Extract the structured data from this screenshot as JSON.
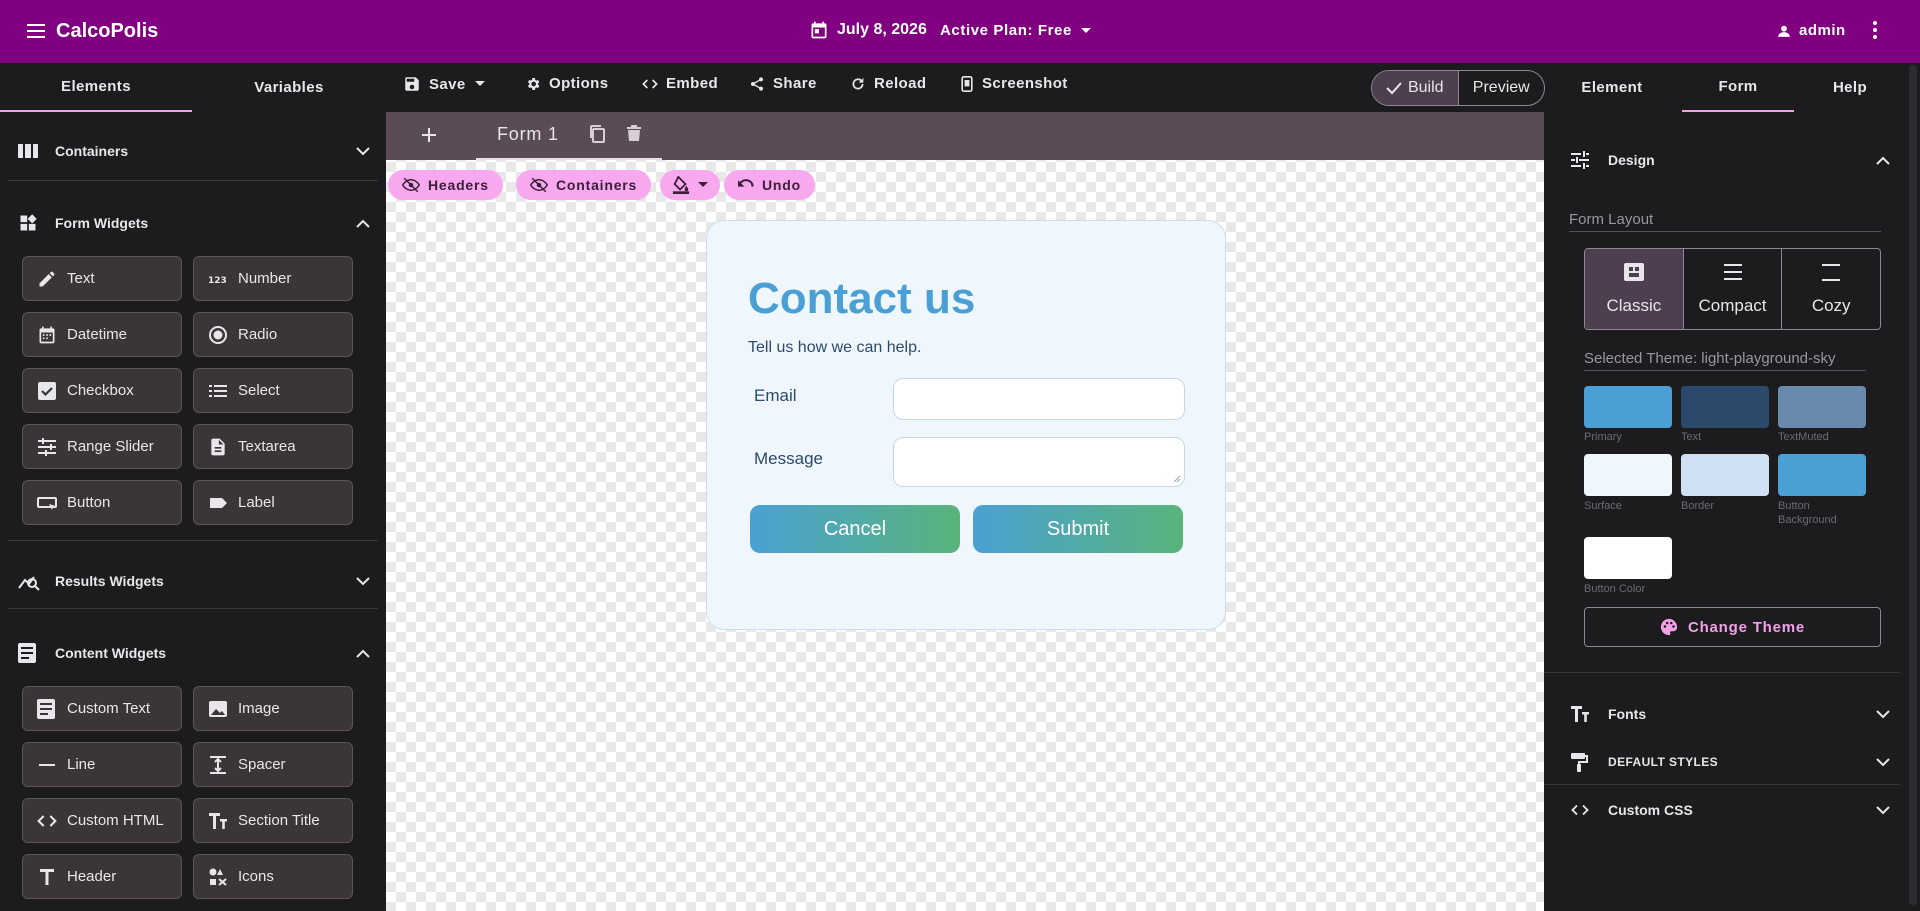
{
  "topbar": {
    "app_title": "CalcoPolis",
    "date": "July 8, 2026",
    "plan": "Active Plan: Free",
    "user": "admin"
  },
  "left_tabs": [
    {
      "label": "Elements",
      "active": true
    },
    {
      "label": "Variables",
      "active": false
    }
  ],
  "toolbar": {
    "save": "Save",
    "options": "Options",
    "embed": "Embed",
    "share": "Share",
    "reload": "Reload",
    "screenshot": "Screenshot"
  },
  "mode_toggle": {
    "build": "Build",
    "preview": "Preview",
    "active": "Build"
  },
  "right_tabs": [
    {
      "label": "Element",
      "active": false
    },
    {
      "label": "Form",
      "active": true
    },
    {
      "label": "Help",
      "active": false
    }
  ],
  "left_panel": {
    "containers": {
      "label": "Containers",
      "icon": "columns-icon",
      "expanded": false
    },
    "form_widgets": {
      "label": "Form Widgets",
      "icon": "widgets-icon",
      "expanded": true,
      "items": [
        {
          "label": "Text",
          "icon": "pencil-icon"
        },
        {
          "label": "Number",
          "icon": "number-icon"
        },
        {
          "label": "Datetime",
          "icon": "calendar-icon"
        },
        {
          "label": "Radio",
          "icon": "radio-icon"
        },
        {
          "label": "Checkbox",
          "icon": "checkbox-icon"
        },
        {
          "label": "Select",
          "icon": "list-icon"
        },
        {
          "label": "Range Slider",
          "icon": "sliders-icon"
        },
        {
          "label": "Textarea",
          "icon": "document-icon"
        },
        {
          "label": "Button",
          "icon": "button-icon"
        },
        {
          "label": "Label",
          "icon": "label-icon"
        }
      ]
    },
    "results_widgets": {
      "label": "Results Widgets",
      "icon": "chart-search-icon",
      "expanded": false
    },
    "content_widgets": {
      "label": "Content Widgets",
      "icon": "article-icon",
      "expanded": true,
      "items": [
        {
          "label": "Custom Text",
          "icon": "article-icon"
        },
        {
          "label": "Image",
          "icon": "image-icon"
        },
        {
          "label": "Line",
          "icon": "line-icon"
        },
        {
          "label": "Spacer",
          "icon": "spacer-icon"
        },
        {
          "label": "Custom HTML",
          "icon": "code-icon"
        },
        {
          "label": "Section Title",
          "icon": "text-size-icon"
        },
        {
          "label": "Header",
          "icon": "header-icon"
        },
        {
          "label": "Icons",
          "icon": "icons-icon"
        }
      ]
    }
  },
  "canvas": {
    "form_tab": "Form 1",
    "chips": {
      "headers": "Headers",
      "containers": "Containers",
      "undo": "Undo"
    },
    "form": {
      "title": "Contact us",
      "subtitle": "Tell us how we can help.",
      "email_label": "Email",
      "email_value": "",
      "message_label": "Message",
      "message_value": "",
      "cancel": "Cancel",
      "submit": "Submit"
    }
  },
  "right_panel": {
    "design": "Design",
    "form_layout": "Form Layout",
    "layouts": [
      {
        "label": "Classic",
        "icon": "grid-icon",
        "selected": true
      },
      {
        "label": "Compact",
        "icon": "compact-lines-icon",
        "selected": false
      },
      {
        "label": "Cozy",
        "icon": "cozy-lines-icon",
        "selected": false
      }
    ],
    "selected_theme": "Selected Theme: light-playground-sky",
    "swatches": [
      {
        "label": "Primary",
        "color": "#4a9fd4"
      },
      {
        "label": "Text",
        "color": "#2b4a6b"
      },
      {
        "label": "TextMuted",
        "color": "#6a8aad"
      },
      {
        "label": "Surface",
        "color": "#eff7fd"
      },
      {
        "label": "Border",
        "color": "#cfe0f2"
      },
      {
        "label": "Button Background",
        "color": "#4a9fd4"
      },
      {
        "label": "Button Color",
        "color": "#ffffff"
      }
    ],
    "change_theme": "Change Theme",
    "fonts": "Fonts",
    "default_styles": "DEFAULT STYLES",
    "custom_css": "Custom CSS"
  },
  "colors": {
    "brand": "#800080",
    "accent": "#f2a0e8",
    "chip": "#f7a8ee"
  }
}
